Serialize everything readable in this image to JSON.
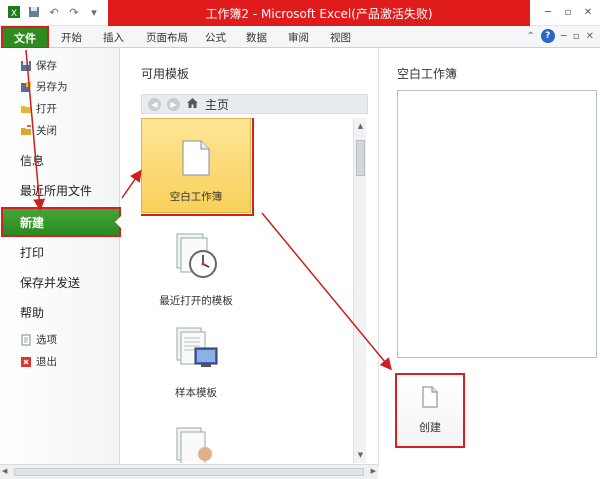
{
  "window": {
    "title": "工作簿2 - Microsoft Excel(产品激活失败)"
  },
  "ribbon": {
    "file_tab": "文件",
    "tabs": [
      "开始",
      "插入",
      "页面布局",
      "公式",
      "数据",
      "审阅",
      "视图"
    ]
  },
  "backstage": {
    "small_items": [
      "保存",
      "另存为",
      "打开",
      "关闭"
    ],
    "big_items": [
      "信息",
      "最近所用文件"
    ],
    "selected_item": "新建",
    "lower_items": [
      "打印",
      "保存并发送",
      "帮助"
    ],
    "bottom_items": [
      "选项",
      "退出"
    ]
  },
  "templates": {
    "title": "可用模板",
    "home_label": "主页",
    "tiles": [
      "空白工作簿",
      "最近打开的模板",
      "样本模板"
    ]
  },
  "preview": {
    "title": "空白工作簿",
    "create_label": "创建"
  },
  "colors": {
    "title_red": "#e01b1b",
    "file_green": "#2f8a1f",
    "highlight_red": "#d61f1f",
    "selected_tile": "#f8d05a"
  }
}
